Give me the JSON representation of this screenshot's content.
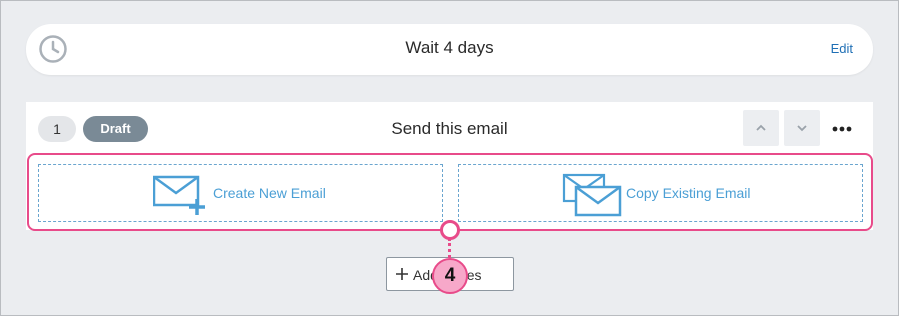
{
  "wait_step": {
    "title": "Wait 4 days",
    "edit_label": "Edit"
  },
  "email_step": {
    "number": "1",
    "status": "Draft",
    "title": "Send this email",
    "options": [
      {
        "label": "Create New Email",
        "icon": "envelope-plus-icon"
      },
      {
        "label": "Copy Existing Email",
        "icon": "envelopes-copy-icon"
      }
    ]
  },
  "add_series": {
    "label": "Add Series"
  },
  "annotation": {
    "marker": "4"
  },
  "colors": {
    "accent_link": "#1f6fb5",
    "option_text": "#4b9fd5",
    "highlight": "#e84b8a",
    "draft_badge": "#7a8a96"
  }
}
